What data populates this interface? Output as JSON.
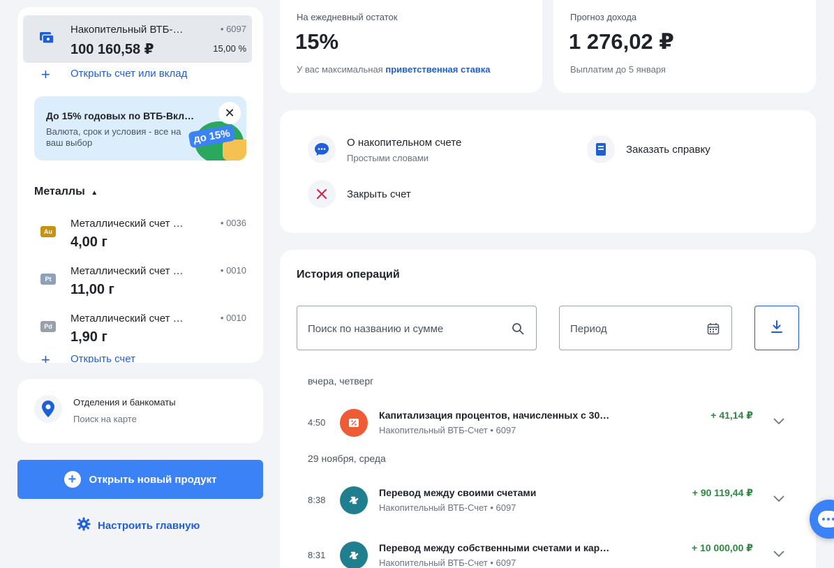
{
  "accounts": {
    "savings": {
      "name": "Накопительный ВТБ-…",
      "number": "• 6097",
      "balance": "100 160,58 ₽",
      "rate": "15,00 %"
    },
    "open_account_label": "Открыть счет или вклад",
    "promo": {
      "title": "До 15% годовых по ВТБ-Вкл…",
      "text": "Валюта, срок и условия - все на ваш выбор",
      "badge": "до 15%"
    },
    "metals_title": "Металлы",
    "metals": [
      {
        "badge": "Au",
        "name": "Металлический счет …",
        "number": "• 0036",
        "balance": "4,00 г",
        "color": "#c8910f"
      },
      {
        "badge": "Pt",
        "name": "Металлический счет …",
        "number": "• 0010",
        "balance": "11,00 г",
        "color": "#8fa0b8"
      },
      {
        "badge": "Pd",
        "name": "Металлический счет …",
        "number": "• 0010",
        "balance": "1,90 г",
        "color": "#98a1ab"
      }
    ],
    "open_metal_label": "Открыть счет"
  },
  "branches": {
    "title": "Отделения и банкоматы",
    "subtitle": "Поиск на карте"
  },
  "new_product_label": "Открыть новый продукт",
  "customize_label": "Настроить главную",
  "rate_card": {
    "label": "На ежедневный остаток",
    "value": "15%",
    "sub_prefix": "У вас максимальная",
    "sub_link": "приветственная ставка"
  },
  "income_card": {
    "label": "Прогноз дохода",
    "value": "1 276,02 ₽",
    "sub": "Выплатим до 5 января"
  },
  "actions": {
    "about": {
      "title": "О накопительном счете",
      "subtitle": "Простыми словами"
    },
    "statement": {
      "title": "Заказать справку"
    },
    "close": {
      "title": "Закрыть счет"
    }
  },
  "history": {
    "title": "История операций",
    "search_placeholder": "Поиск по названию и сумме",
    "period_placeholder": "Период",
    "groups": [
      {
        "date": "вчера, четверг",
        "items": [
          {
            "time": "4:50",
            "name": "Капитализация процентов, начисленных с 30…",
            "account": "Накопительный ВТБ-Счет • 6097",
            "amount": "+ 41,14 ₽",
            "icon": "percent-icon"
          }
        ]
      },
      {
        "date": "29 ноября, среда",
        "items": [
          {
            "time": "8:38",
            "name": "Перевод между своими счетами",
            "account": "Накопительный ВТБ-Счет • 6097",
            "amount": "+ 90 119,44 ₽",
            "icon": "transfer-icon"
          },
          {
            "time": "8:31",
            "name": "Перевод между собственными счетами и кар…",
            "account": "Накопительный ВТБ-Счет • 6097",
            "amount": "+ 10 000,00 ₽",
            "icon": "transfer-icon"
          }
        ]
      }
    ]
  },
  "colors": {
    "accent": "#3b82f6",
    "link": "#1d5fd6",
    "positive": "#2b8a3e",
    "percent_icon": "#ef5b34",
    "transfer_icon": "#1f7f8f",
    "close_icon": "#d0214e"
  }
}
